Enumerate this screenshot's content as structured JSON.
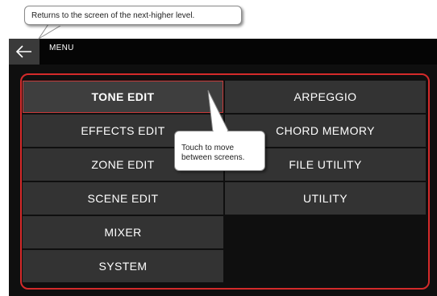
{
  "annotations": {
    "back_hint": "Returns to the screen of the next-higher level.",
    "move_hint": "Touch to move between screens."
  },
  "titlebar": {
    "back_icon": "left-arrow-icon",
    "title": "MENU"
  },
  "menu": {
    "selected": "TONE EDIT",
    "items": [
      {
        "label": "TONE EDIT"
      },
      {
        "label": "ARPEGGIO"
      },
      {
        "label": "EFFECTS EDIT"
      },
      {
        "label": "CHORD MEMORY"
      },
      {
        "label": "ZONE EDIT"
      },
      {
        "label": "FILE UTILITY"
      },
      {
        "label": "SCENE EDIT"
      },
      {
        "label": "UTILITY"
      },
      {
        "label": "MIXER"
      },
      {
        "label": "SYSTEM"
      }
    ]
  },
  "colors": {
    "highlight_outline": "#d42a2a",
    "button_bg": "#333333",
    "screen_bg": "#0f0f0f"
  }
}
